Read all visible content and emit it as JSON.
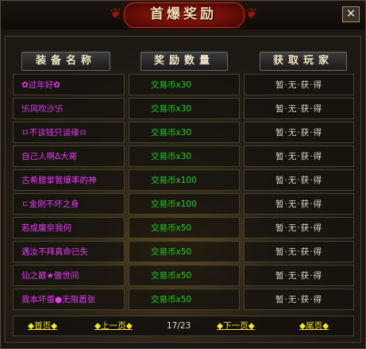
{
  "window": {
    "title": "首爆奖励",
    "close_glyph": "✕"
  },
  "headers": {
    "name": "装备名称",
    "reward": "奖励数量",
    "winner": "获取玩家"
  },
  "rows": [
    {
      "name": "✿过年好✿",
      "reward": "交易币x30",
      "winner": "暂·无·获·得"
    },
    {
      "name": "卐风吹沙卐",
      "reward": "交易币x30",
      "winner": "暂·无·获·得"
    },
    {
      "name": "ㅁ不谈钱只谈缘ㅁ",
      "reward": "交易币x30",
      "winner": "暂·无·获·得"
    },
    {
      "name": "自己人啊Δ大哥",
      "reward": "交易币x30",
      "winner": "暂·无·获·得"
    },
    {
      "name": "古希腊掌管爆率的神",
      "reward": "交易币x100",
      "winner": "暂·无·获·得"
    },
    {
      "name": "ㄷ金刚不坏之身",
      "reward": "交易币x100",
      "winner": "暂·无·获·得"
    },
    {
      "name": "若成魔奈我何",
      "reward": "交易币x50",
      "winner": "暂·无·获·得"
    },
    {
      "name": "遇汝不拜真命已失",
      "reward": "交易币x50",
      "winner": "暂·无·获·得"
    },
    {
      "name": "仙之巅★傲世间",
      "reward": "交易币x50",
      "winner": "暂·无·获·得"
    },
    {
      "name": "我本坏蛋●无限嚣张",
      "reward": "交易币x50",
      "winner": "暂·无·获·得"
    }
  ],
  "pager": {
    "first": "首页",
    "prev": "上一页",
    "info": "17/23",
    "next": "下一页",
    "last": "尾页",
    "diamond": "◆"
  },
  "colors": {
    "item_name": "#e23df0",
    "reward": "#1fd426",
    "pager_link": "#f5e637",
    "title_plate": "#8a140c"
  }
}
